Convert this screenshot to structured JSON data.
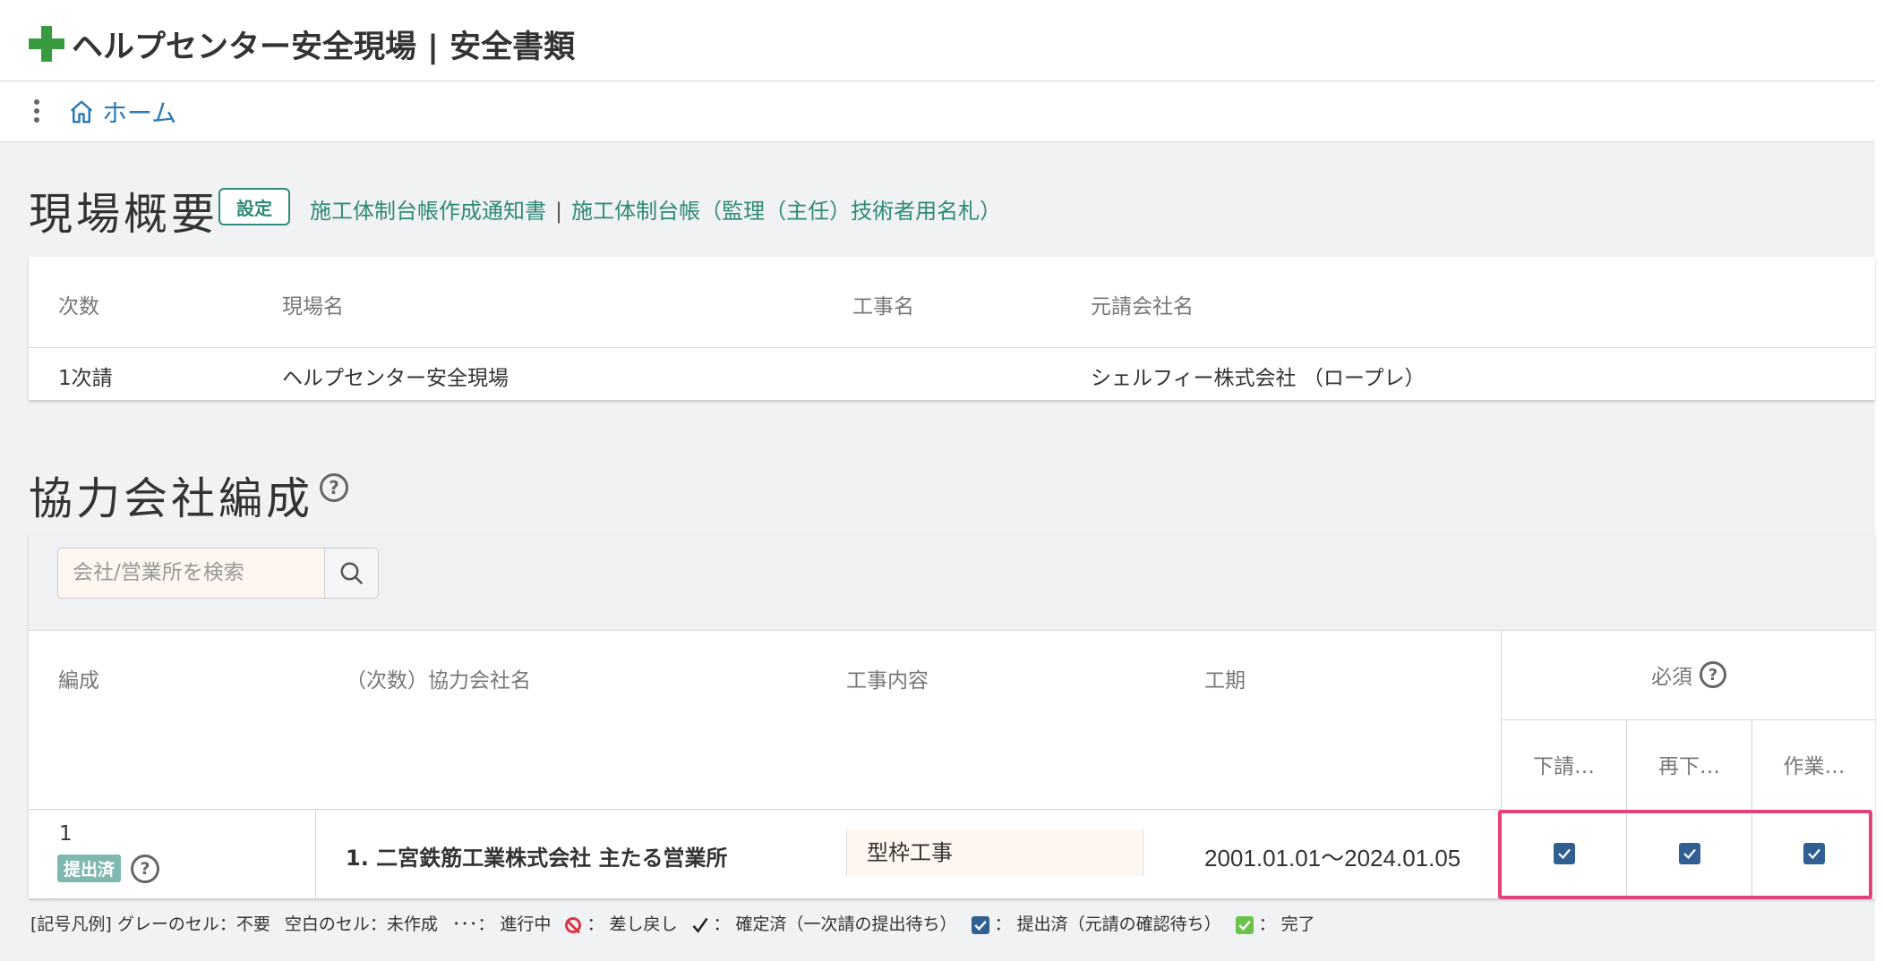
{
  "app": {
    "title": "ヘルプセンター安全現場 | 安全書類"
  },
  "nav": {
    "home_label": "ホーム"
  },
  "site_overview": {
    "title": "現場概要",
    "settings_button": "設定",
    "link1": "施工体制台帳作成通知書",
    "separator": "|",
    "link2": "施工体制台帳（監理（主任）技術者用名札）",
    "headers": [
      "次数",
      "現場名",
      "工事名",
      "元請会社名"
    ],
    "row": [
      "1次請",
      "ヘルプセンター安全現場",
      "",
      "シェルフィー株式会社 （ロープレ）"
    ]
  },
  "partners": {
    "title": "協力会社編成",
    "search_placeholder": "会社/営業所を検索",
    "headers": {
      "formation": "編成",
      "company": "（次数）協力会社名",
      "work": "工事内容",
      "period": "工期",
      "required": "必須",
      "sub1": "下請…",
      "sub2": "再下…",
      "sub3": "作業…"
    },
    "rows": [
      {
        "num": "1",
        "status": "提出済",
        "company": "1. 二宮鉄筋工業株式会社 主たる営業所",
        "work": "型枠工事",
        "period": "2001.01.01〜2024.01.05"
      }
    ]
  },
  "legend": {
    "prefix": "[記号凡例] グレーのセル：不要",
    "blank": "空白のセル：未作成",
    "dots": "･･･： 進行中",
    "rejected": "： 差し戻し",
    "confirmed": "： 確定済（一次請の提出待ち）",
    "submitted": "： 提出済（元請の確認待ち）",
    "done": "： 完了"
  },
  "colors": {
    "accent": "#2e8a7a",
    "link": "#2b7ab8",
    "check": "#2f5f93",
    "highlight": "#e6437a",
    "done": "#6cc24a"
  }
}
